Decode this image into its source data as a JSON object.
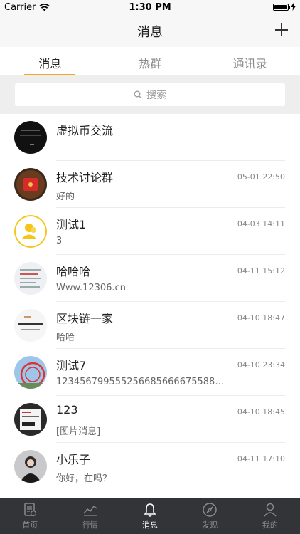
{
  "status_bar": {
    "carrier": "Carrier",
    "time": "1:30 PM"
  },
  "nav": {
    "title": "消息"
  },
  "tabs": [
    {
      "label": "消息",
      "active": true
    },
    {
      "label": "热群",
      "active": false
    },
    {
      "label": "通讯录",
      "active": false
    }
  ],
  "search": {
    "placeholder": "搜索"
  },
  "conversations": [
    {
      "name": "虚拟币交流",
      "message": "",
      "time": ""
    },
    {
      "name": "技术讨论群",
      "message": "好的",
      "time": "05-01 22:50"
    },
    {
      "name": "测试1",
      "message": "3",
      "time": "04-03 14:11"
    },
    {
      "name": "哈哈哈",
      "message": "Www.12306.cn",
      "time": "04-11 15:12"
    },
    {
      "name": "区块链一家",
      "message": "哈哈",
      "time": "04-10 18:47"
    },
    {
      "name": "测试7",
      "message": "1234567995552566856666755885...",
      "time": "04-10 23:34"
    },
    {
      "name": "123",
      "message": "[图片消息]",
      "time": "04-10 18:45"
    },
    {
      "name": "小乐子",
      "message": "你好，在吗？",
      "time": "04-11 17:10"
    }
  ],
  "tabbar": [
    {
      "label": "首页",
      "icon": "home-doc-icon",
      "active": false
    },
    {
      "label": "行情",
      "icon": "market-chart-icon",
      "active": false
    },
    {
      "label": "消息",
      "icon": "bell-icon",
      "active": true
    },
    {
      "label": "发现",
      "icon": "compass-icon",
      "active": false
    },
    {
      "label": "我的",
      "icon": "person-icon",
      "active": false
    }
  ],
  "colors": {
    "accent": "#f5a623",
    "tabbar_bg": "#333438",
    "search_bg": "#eeeeee"
  }
}
